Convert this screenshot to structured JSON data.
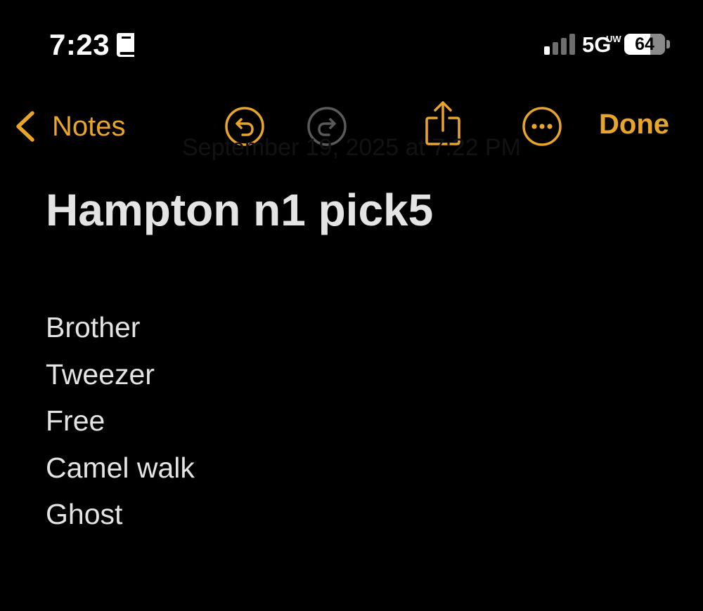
{
  "status_bar": {
    "time": "7:23",
    "network": "5G",
    "network_superscript": "UW",
    "battery_level": 64,
    "battery_label": "64",
    "icons": [
      "book-icon",
      "signal-icon",
      "battery-icon"
    ]
  },
  "nav": {
    "back_label": "Notes",
    "back_icon": "chevron-left-icon",
    "undo_icon": "undo-icon",
    "redo_icon": "redo-icon",
    "share_icon": "share-icon",
    "more_icon": "more-icon",
    "done_label": "Done",
    "redo_enabled": false
  },
  "note": {
    "date_faint": "September 19, 2025 at 7:22 PM",
    "title": "Hampton n1 pick5",
    "lines": [
      "Brother",
      "Tweezer",
      "Free",
      "Camel walk",
      "Ghost"
    ]
  },
  "colors": {
    "background": "#000000",
    "accent": "#E8A52C",
    "text": "#E4E4E4",
    "disabled": "#5A5A5A"
  }
}
